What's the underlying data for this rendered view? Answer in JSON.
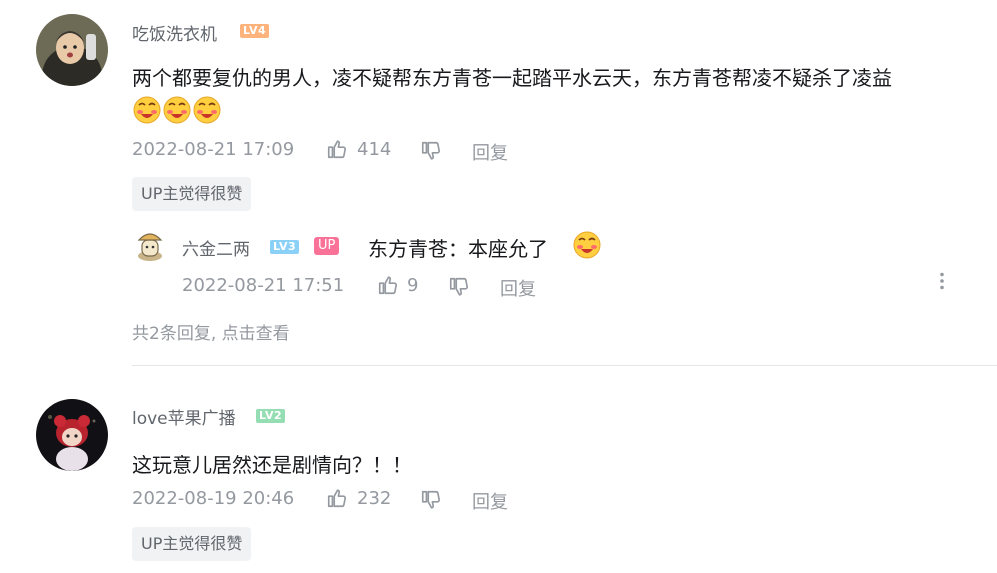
{
  "comments": [
    {
      "username": "吃饭洗衣机",
      "level": "LV4",
      "level_color": "#ffb37c",
      "text": "两个都要复仇的男人，凌不疑帮东方青苍一起踏平水云天，东方青苍帮凌不疑杀了凌益",
      "emoji_count": 3,
      "timestamp": "2022-08-21 17:09",
      "likes": "414",
      "reply_label": "回复",
      "badge": "UP主觉得很赞",
      "replies": [
        {
          "username": "六金二两",
          "level": "LV3",
          "level_color": "#8bd1f7",
          "up_tag": "UP",
          "text": "东方青苍：本座允了",
          "timestamp": "2022-08-21 17:51",
          "likes": "9",
          "reply_label": "回复"
        }
      ],
      "reply_summary": "共2条回复, 点击查看"
    },
    {
      "username": "love苹果广播",
      "level": "LV2",
      "level_color": "#95ddb2",
      "text": "这玩意儿居然还是剧情向？！！",
      "timestamp": "2022-08-19 20:46",
      "likes": "232",
      "reply_label": "回复",
      "badge": "UP主觉得很赞"
    }
  ],
  "icons": {
    "like": "thumb-up-icon",
    "dislike": "thumb-down-icon",
    "more": "more-vertical-icon",
    "emoji": "blushing-face-emoji"
  }
}
